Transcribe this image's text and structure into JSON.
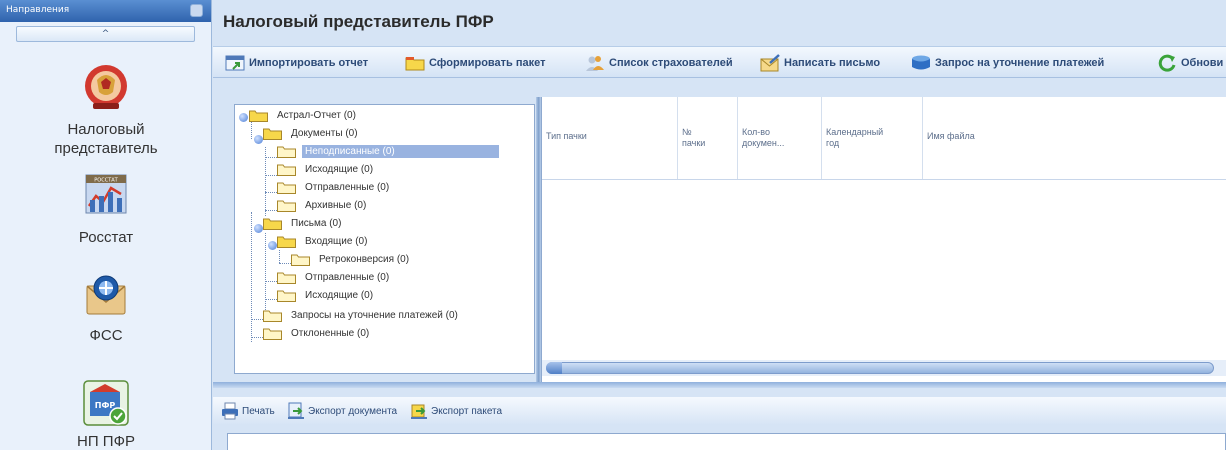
{
  "nav": {
    "header": "Направления",
    "collapse_glyph": "^",
    "items": [
      {
        "label": "Налоговый\nпредставитель",
        "icon": "tax-representative-icon"
      },
      {
        "label": "Росстат",
        "icon": "rosstat-icon",
        "icon_caption": "РОССТАТ"
      },
      {
        "label": "ФСС",
        "icon": "fss-icon"
      },
      {
        "label": "НП ПФР",
        "icon": "pfr-icon",
        "icon_caption": "ПФР"
      }
    ]
  },
  "main": {
    "title": "Налоговый представитель ПФР",
    "toolbar": [
      {
        "label": "Импортировать отчет",
        "icon": "import-report-icon"
      },
      {
        "label": "Сформировать пакет",
        "icon": "folder-icon"
      },
      {
        "label": "Список страхователей",
        "icon": "users-list-icon"
      },
      {
        "label": "Написать письмо",
        "icon": "envelope-icon"
      },
      {
        "label": "Запрос на уточнение платежей",
        "icon": "request-icon"
      },
      {
        "label": "Обнови",
        "icon": "refresh-icon"
      }
    ],
    "tree": {
      "root": "Астрал-Отчет (0)",
      "documents": "Документы (0)",
      "unsigned": "Неподписанные (0)",
      "outgoing": "Исходящие (0)",
      "sent": "Отправленные (0)",
      "archive": "Архивные (0)",
      "letters": "Письма (0)",
      "incoming": "Входящие (0)",
      "retroconversion": "Ретроконверсия (0)",
      "letters_sent": "Отправленные (0)",
      "letters_outgoing": "Исходящие (0)",
      "payment_requests": "Запросы на уточнение платежей (0)",
      "rejected": "Отклоненные (0)"
    },
    "grid": {
      "columns": [
        "Тип пачки",
        "№\nпачки",
        "Кол-во\nдокумен...",
        "Календарный\nгод",
        "Имя файла"
      ]
    },
    "bottom_toolbar": [
      {
        "label": "Печать",
        "icon": "printer-icon"
      },
      {
        "label": "Экспорт документа",
        "icon": "export-document-icon"
      },
      {
        "label": "Экспорт пакета",
        "icon": "export-package-icon"
      }
    ]
  },
  "colors": {
    "accent": "#2f63ad",
    "selection": "#99b3e0",
    "folder": "#f7d74a",
    "panel_bg": "#d6e4f5"
  }
}
